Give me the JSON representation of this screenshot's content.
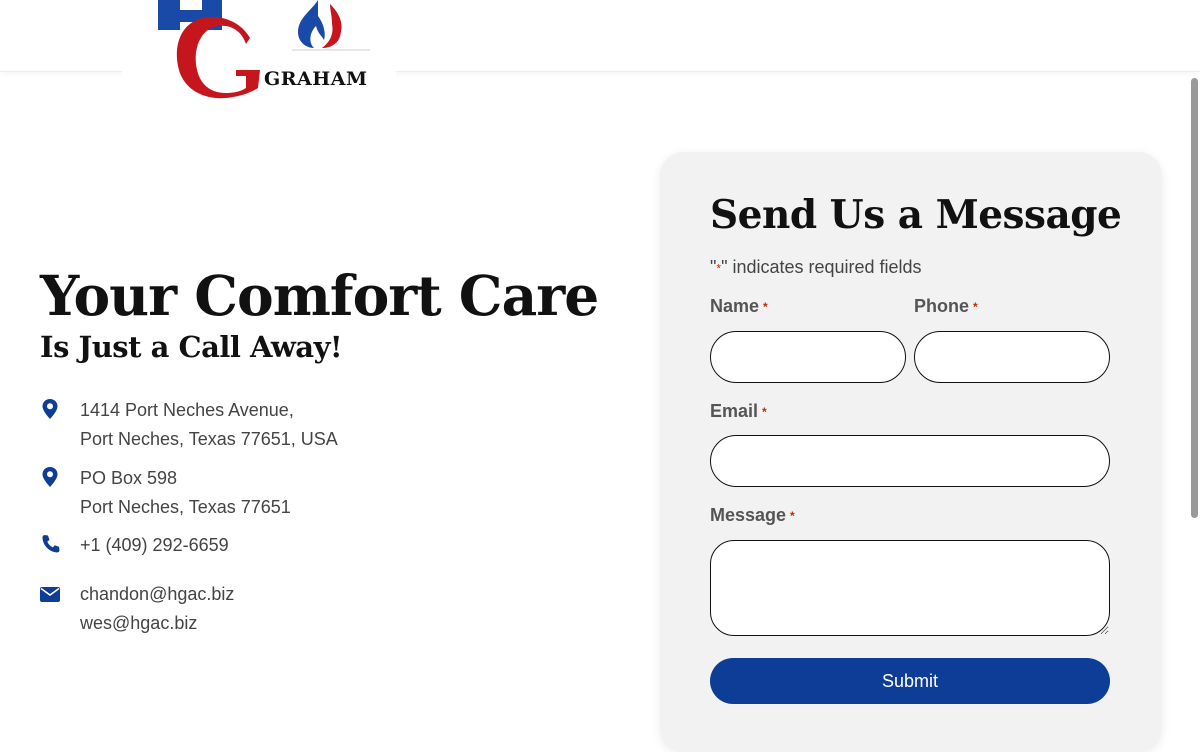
{
  "brand": {
    "logo_text": "GRAHAM",
    "colors": {
      "red": "#c4161c",
      "blue": "#1a4aa8",
      "accent": "#0d3d96",
      "required": "#c02b0a"
    }
  },
  "hero": {
    "title": "Your Comfort Care",
    "subtitle": "Is Just a Call Away!"
  },
  "contact": {
    "address1": {
      "icon": "map-pin-icon",
      "line1": "1414 Port Neches Avenue,",
      "line2": "Port Neches, Texas 77651, USA"
    },
    "address2": {
      "icon": "map-pin-icon",
      "line1": "PO Box 598",
      "line2": "Port Neches, Texas 77651"
    },
    "phone": {
      "icon": "phone-icon",
      "text": "+1 (409) 292-6659"
    },
    "email": {
      "icon": "envelope-icon",
      "email1": "chandon@hgac.biz",
      "email2": "wes@hgac.biz"
    }
  },
  "form": {
    "title": "Send Us a Message",
    "required_note_prefix": "\"",
    "required_note_star": "*",
    "required_note_suffix": "\" indicates required fields",
    "fields": {
      "name": {
        "label": "Name",
        "value": ""
      },
      "phone": {
        "label": "Phone",
        "value": ""
      },
      "email": {
        "label": "Email",
        "value": ""
      },
      "message": {
        "label": "Message",
        "value": ""
      }
    },
    "required_star": "*",
    "submit_label": "Submit"
  }
}
